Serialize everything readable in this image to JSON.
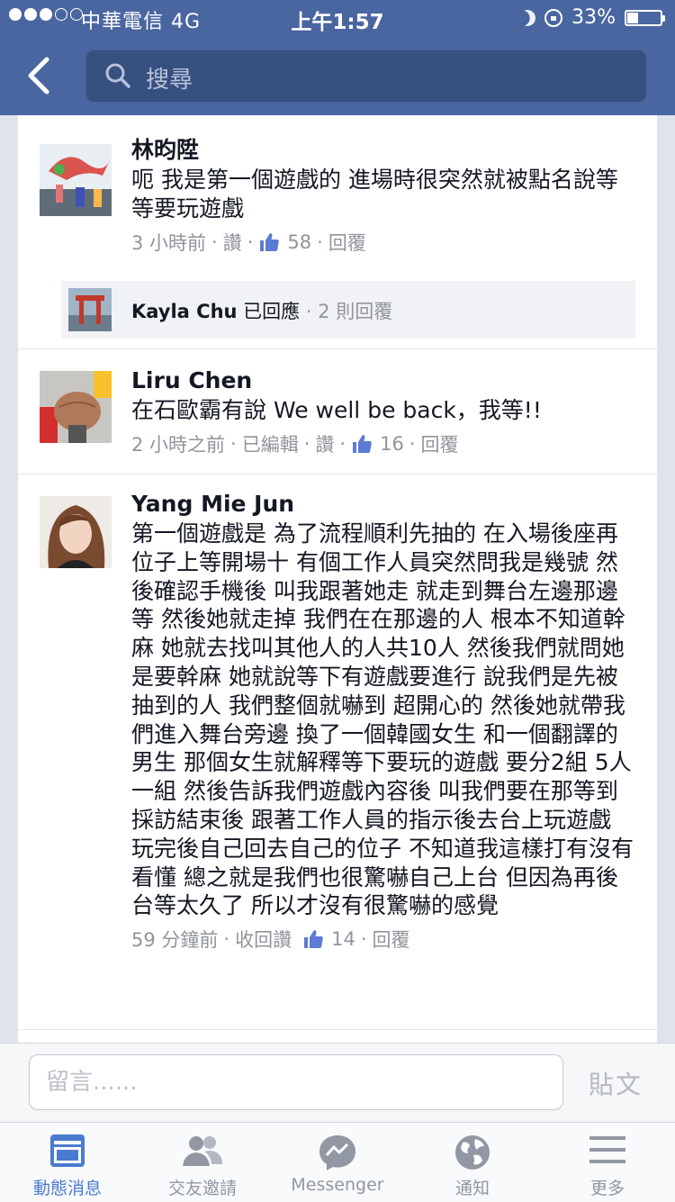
{
  "status_bar": {
    "carrier": "中華電信  4G",
    "time": "上午1:57",
    "battery": "33%",
    "battery_level": 0.33,
    "signal_bars_filled": 3,
    "signal_bars_total": 5
  },
  "header": {
    "search_placeholder": "搜尋",
    "back_icon": "chevron-left-icon",
    "search_icon": "search-icon",
    "brand_color": "#4a66a0"
  },
  "comments": [
    {
      "name": "林昀陞",
      "text": "呃 我是第一個遊戲的 進場時很突然就被點名說等等要玩遊戲",
      "time": "3 小時前",
      "actions": [
        "讚"
      ],
      "likes": "58",
      "reply_label": "回覆",
      "replies": {
        "name": "Kayla Chu",
        "verb": "已回應",
        "count": "· 2 則回覆"
      }
    },
    {
      "name": "Liru Chen",
      "text": "在石歐霸有說 We well be back，我等!!",
      "time": "2 小時之前",
      "actions": [
        "已編輯",
        "讚"
      ],
      "likes": "16",
      "reply_label": "回覆"
    },
    {
      "name": "Yang Mie Jun",
      "text": "第一個遊戲是 為了流程順利先抽的 在入場後座再位子上等開場十 有個工作人員突然問我是幾號 然後確認手機後 叫我跟著她走 就走到舞台左邊那邊等 然後她就走掉 我們在在那邊的人 根本不知道幹麻 她就去找叫其他人的人共10人 然後我們就問她 是要幹麻 她就說等下有遊戲要進行 說我們是先被抽到的人 我們整個就嚇到 超開心的 然後她就帶我們進入舞台旁邊 換了一個韓國女生 和一個翻譯的男生 那個女生就解釋等下要玩的遊戲 要分2組 5人一組 然後告訴我們遊戲內容後 叫我們要在那等到採訪結束後 跟著工作人員的指示後去台上玩遊戲 玩完後自己回去自己的位子 不知道我這樣打有沒有看懂 總之就是我們也很驚嚇自己上台 但因為再後台等太久了 所以才沒有很驚嚇的感覺",
      "time": "59 分鐘前",
      "actions": [
        "收回讚"
      ],
      "likes": "14",
      "reply_label": "回覆"
    }
  ],
  "compose": {
    "placeholder": "留言......",
    "post_label": "貼文"
  },
  "tabs": [
    {
      "label": "動態消息",
      "icon": "news-feed-icon",
      "active": true
    },
    {
      "label": "交友邀請",
      "icon": "friend-requests-icon",
      "active": false
    },
    {
      "label": "Messenger",
      "icon": "messenger-icon",
      "active": false
    },
    {
      "label": "通知",
      "icon": "globe-icon",
      "active": false
    },
    {
      "label": "更多",
      "icon": "menu-icon",
      "active": false
    }
  ],
  "colors": {
    "header": "#4a66a0",
    "search_box": "#36507f",
    "meta_text": "#90949c",
    "active_tab": "#4a7bd0",
    "inactive_tab": "#9197a3"
  }
}
